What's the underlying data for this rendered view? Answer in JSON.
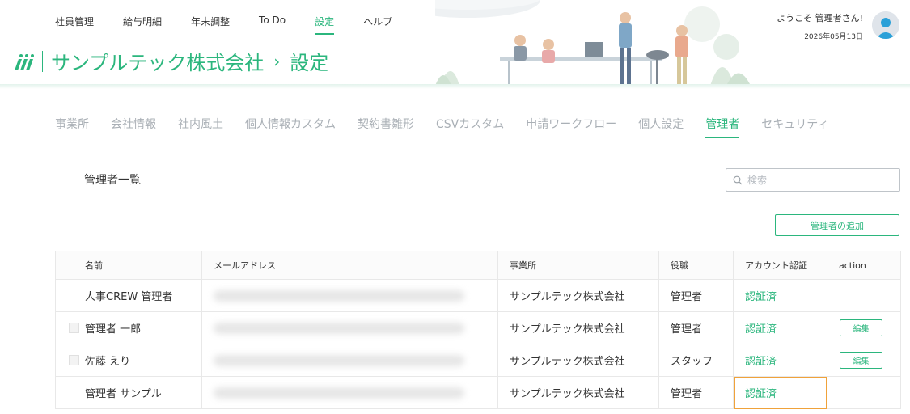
{
  "header": {
    "nav": [
      "社員管理",
      "給与明細",
      "年末調整",
      "To Do",
      "設定",
      "ヘルプ"
    ],
    "nav_active_index": 4,
    "company": "サンプルテック株式会社",
    "arrow": "›",
    "page": "設定",
    "welcome": "ようこそ 管理者さん!",
    "date": "2026年05月13日",
    "brand_color": "#2bb67d"
  },
  "tabs": {
    "items": [
      "事業所",
      "会社情報",
      "社内風土",
      "個人情報カスタム",
      "契約書雛形",
      "CSVカスタム",
      "申請ワークフロー",
      "個人設定",
      "管理者",
      "セキュリティ"
    ],
    "active_index": 8
  },
  "section": {
    "title": "管理者一覧",
    "search_placeholder": "検索",
    "add_button": "管理者の追加"
  },
  "table": {
    "headers": [
      "名前",
      "メールアドレス",
      "事業所",
      "役職",
      "アカウント認証",
      "action"
    ],
    "rows": [
      {
        "name": "人事CREW 管理者",
        "office": "サンプルテック株式会社",
        "role": "管理者",
        "status": "認証済",
        "action": ""
      },
      {
        "name": "管理者 一郎",
        "office": "サンプルテック株式会社",
        "role": "管理者",
        "status": "認証済",
        "action": "編集"
      },
      {
        "name": "佐藤 えり",
        "office": "サンプルテック株式会社",
        "role": "スタッフ",
        "status": "認証済",
        "action": "編集"
      },
      {
        "name": "管理者 サンプル",
        "office": "サンプルテック株式会社",
        "role": "管理者",
        "status": "認証済",
        "action": ""
      }
    ]
  }
}
